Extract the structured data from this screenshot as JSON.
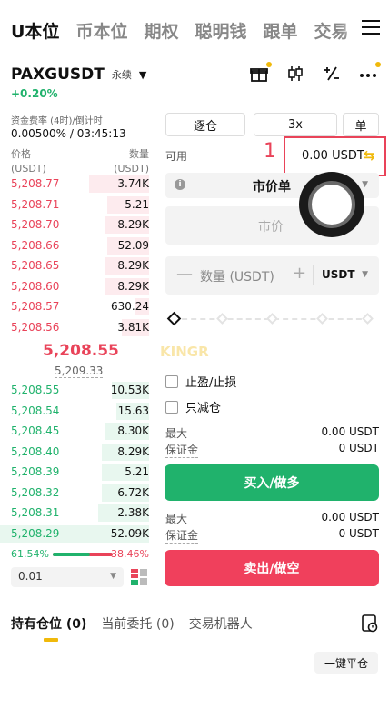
{
  "nav": {
    "tabs": [
      "U本位",
      "币本位",
      "期权",
      "聪明钱",
      "跟单",
      "交易"
    ],
    "active_index": 0
  },
  "pair": {
    "name": "PAXGUSDT",
    "tag": "永续",
    "change": "+0.20%"
  },
  "funding": {
    "label": "资金费率 (4时)/倒计时",
    "value": "0.00500% / 03:45:13"
  },
  "orderbook": {
    "price_header": "价格",
    "price_unit": "(USDT)",
    "qty_header": "数量",
    "qty_unit": "(USDT)",
    "asks": [
      {
        "price": "5,208.77",
        "qty": "3.74K",
        "depth": 0.4
      },
      {
        "price": "5,208.71",
        "qty": "5.21",
        "depth": 0.28
      },
      {
        "price": "5,208.70",
        "qty": "8.29K",
        "depth": 0.3
      },
      {
        "price": "5,208.66",
        "qty": "52.09",
        "depth": 0.28
      },
      {
        "price": "5,208.65",
        "qty": "8.29K",
        "depth": 0.3
      },
      {
        "price": "5,208.60",
        "qty": "8.29K",
        "depth": 0.3
      },
      {
        "price": "5,208.57",
        "qty": "630.24",
        "depth": 0.1
      },
      {
        "price": "5,208.56",
        "qty": "3.81K",
        "depth": 0.18
      }
    ],
    "last_price": "5,208.55",
    "mark_price": "5,209.33",
    "bids": [
      {
        "price": "5,208.55",
        "qty": "10.53K",
        "depth": 0.25
      },
      {
        "price": "5,208.54",
        "qty": "15.63",
        "depth": 0.22
      },
      {
        "price": "5,208.45",
        "qty": "8.30K",
        "depth": 0.3
      },
      {
        "price": "5,208.40",
        "qty": "8.29K",
        "depth": 0.32
      },
      {
        "price": "5,208.39",
        "qty": "5.21",
        "depth": 0.32
      },
      {
        "price": "5,208.32",
        "qty": "6.72K",
        "depth": 0.32
      },
      {
        "price": "5,208.31",
        "qty": "2.38K",
        "depth": 0.34
      },
      {
        "price": "5,208.29",
        "qty": "52.09K",
        "depth": 1.0
      }
    ],
    "buy_ratio": "61.54%",
    "sell_ratio": "38.46%",
    "buy_ratio_value": 0.6154,
    "precision": "0.01"
  },
  "order_form": {
    "margin_mode": "逐仓",
    "leverage": "3x",
    "position_mode": "单",
    "available_label": "可用",
    "annotation": "1",
    "available_value": "0.00 USDT",
    "order_type": "市价单",
    "price_placeholder": "市价",
    "qty_placeholder": "数量 (USDT)",
    "qty_unit": "USDT",
    "watermark": "KINGR",
    "options": [
      "止盈/止损",
      "只减仓"
    ],
    "buy": {
      "max_label": "最大",
      "max_value": "0.00 USDT",
      "margin_label": "保证金",
      "margin_value": "0 USDT",
      "button": "买入/做多"
    },
    "sell": {
      "max_label": "最大",
      "max_value": "0.00 USDT",
      "margin_label": "保证金",
      "margin_value": "0 USDT",
      "button": "卖出/做空"
    }
  },
  "bottom": {
    "tabs": [
      "持有仓位 (0)",
      "当前委托 (0)",
      "交易机器人"
    ],
    "close_all": "一键平仓"
  },
  "colors": {
    "buy": "#20b26c",
    "sell": "#f0405c",
    "accent": "#f0b90b"
  }
}
